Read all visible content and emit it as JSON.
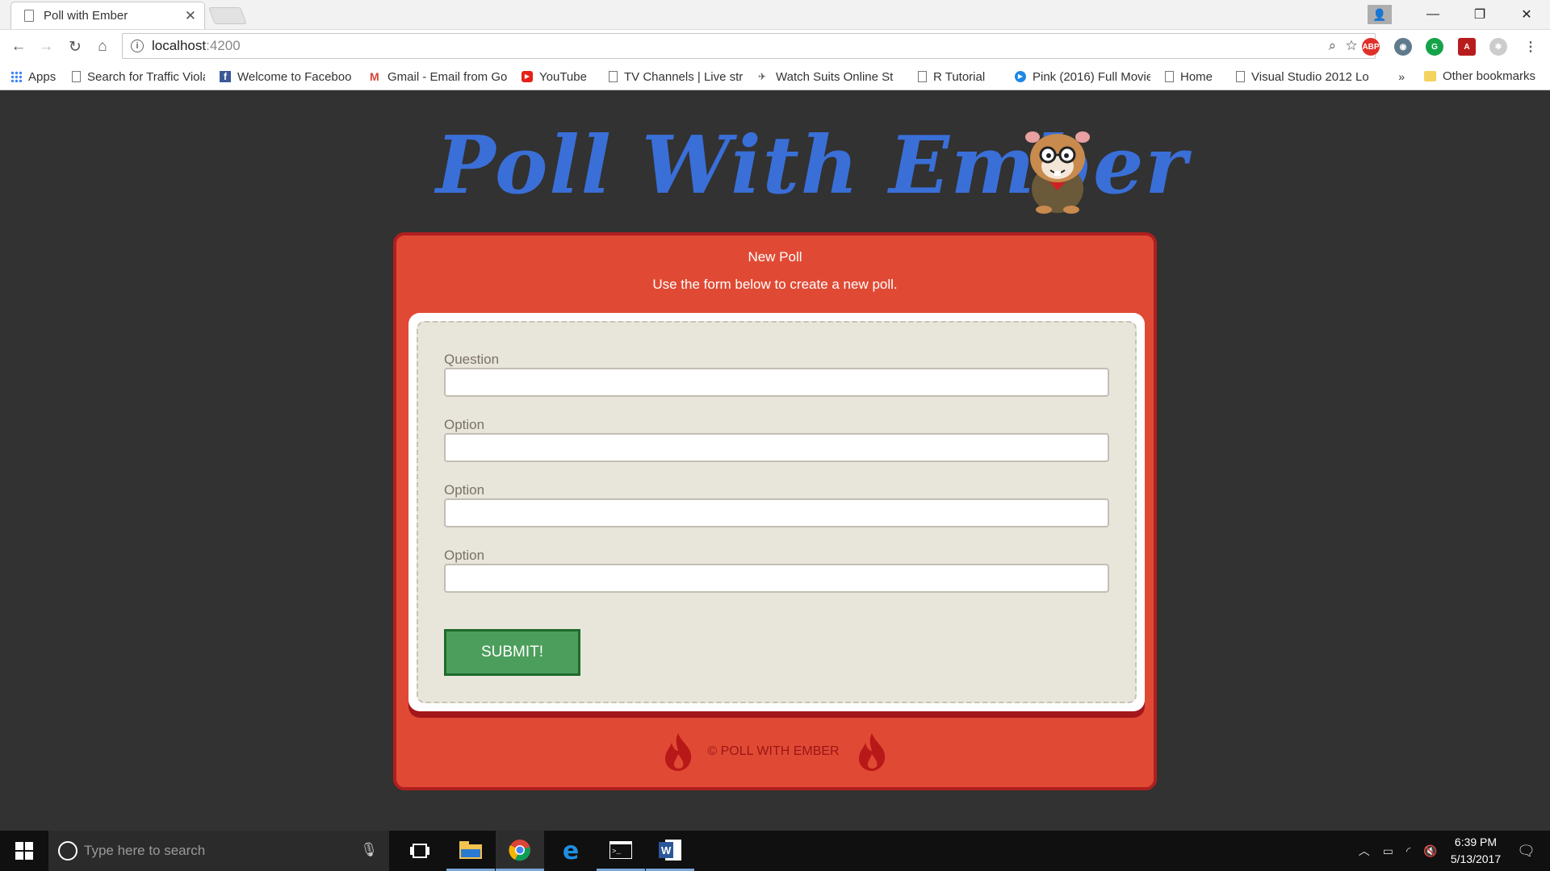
{
  "browser": {
    "tab_title": "Poll with Ember",
    "url_host": "localhost",
    "url_port": ":4200",
    "bookmarks": [
      {
        "label": "Apps",
        "icon": "apps-grid-icon"
      },
      {
        "label": "Search for Traffic Viola",
        "icon": "page-icon"
      },
      {
        "label": "Welcome to Faceboo",
        "icon": "facebook-icon"
      },
      {
        "label": "Gmail - Email from Go",
        "icon": "gmail-icon"
      },
      {
        "label": "YouTube",
        "icon": "youtube-icon"
      },
      {
        "label": "TV Channels | Live str",
        "icon": "page-icon"
      },
      {
        "label": "Watch Suits Online St",
        "icon": "suits-icon"
      },
      {
        "label": "R Tutorial",
        "icon": "page-icon"
      },
      {
        "label": "Pink (2016) Full Movie",
        "icon": "pink-icon"
      },
      {
        "label": "Home",
        "icon": "page-icon"
      },
      {
        "label": "Visual Studio 2012 Lo",
        "icon": "page-icon"
      }
    ],
    "bookmarks_more": "»",
    "other_bookmarks": "Other bookmarks"
  },
  "page": {
    "logo_text": "Poll With Ember",
    "card_title": "New Poll",
    "card_subtitle": "Use the form below to create a new poll.",
    "fields": [
      {
        "label": "Question",
        "value": "",
        "placeholder": ""
      },
      {
        "label": "Option",
        "value": "",
        "placeholder": ""
      },
      {
        "label": "Option",
        "value": "",
        "placeholder": ""
      },
      {
        "label": "Option",
        "value": "",
        "placeholder": ""
      }
    ],
    "submit_label": "SUBMIT!",
    "footer_text": "© POLL WITH EMBER"
  },
  "taskbar": {
    "search_placeholder": "Type here to search",
    "time": "6:39 PM",
    "date": "5/13/2017"
  },
  "colors": {
    "card_bg": "#e04a34",
    "card_border": "#b01f1f",
    "form_bg": "#e8e5da",
    "submit_bg": "#4c9e5c",
    "logo_color": "#3a6fd8",
    "page_bg": "#323232"
  }
}
